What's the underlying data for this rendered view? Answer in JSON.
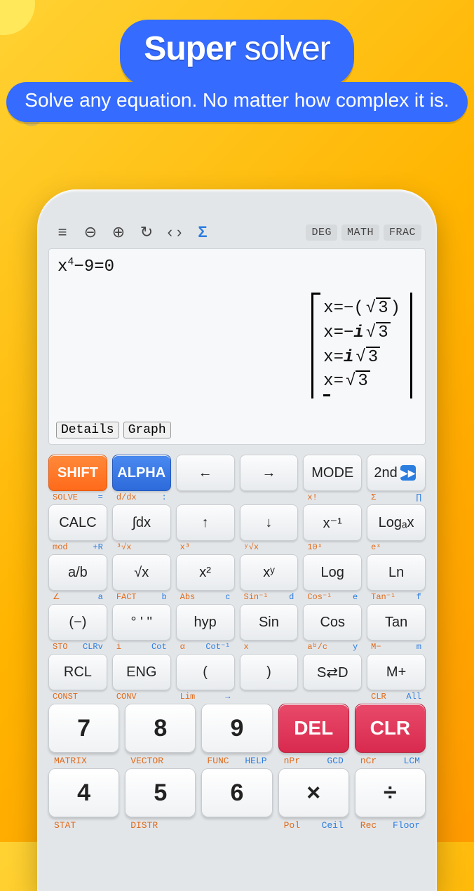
{
  "hero": {
    "title_strong": "Super",
    "title_rest": " solver",
    "subtitle": "Solve any equation. No matter how complex it is."
  },
  "toolbar": {
    "menu": "≡",
    "zoom_out": "⊖",
    "zoom_in": "⊕",
    "refresh": "↻",
    "code": "‹ ›",
    "sigma": "Σ",
    "modes": [
      "DEG",
      "MATH",
      "FRAC"
    ]
  },
  "display": {
    "expression_base": "x",
    "expression_exp": "4",
    "expression_rest": "−9=0",
    "solutions": {
      "s1_pre": "x=−(",
      "s1_rad": "3",
      "s1_post": ")",
      "s2_pre": "x=−",
      "s2_i": "i",
      "s2_rad": "3",
      "s3_pre": "x=",
      "s3_i": "i",
      "s3_rad": "3",
      "s4_pre": "x=",
      "s4_rad": "3"
    },
    "details_btn": "Details",
    "graph_btn": "Graph"
  },
  "row1": {
    "shift": "SHIFT",
    "alpha": "ALPHA",
    "left": "←",
    "right": "→",
    "mode": "MODE",
    "second": "2nd"
  },
  "hints1": [
    {
      "l": "SOLVE",
      "r": "="
    },
    {
      "l": "d/dx",
      "r": ":"
    },
    {
      "l": "",
      "r": ""
    },
    {
      "l": "",
      "r": ""
    },
    {
      "l": "x!",
      "r": ""
    },
    {
      "l": "Σ",
      "r": "∏"
    }
  ],
  "row2": [
    "CALC",
    "∫dx",
    "↑",
    "↓",
    "x⁻¹",
    "Logₐx"
  ],
  "hints2": [
    {
      "l": "mod",
      "r": "+R"
    },
    {
      "l": "³√x",
      "r": ""
    },
    {
      "l": "x³",
      "r": ""
    },
    {
      "l": "ʸ√x",
      "r": ""
    },
    {
      "l": "10ˣ",
      "r": ""
    },
    {
      "l": "eˣ",
      "r": ""
    }
  ],
  "row3": [
    "a/b",
    "√x",
    "x²",
    "xʸ",
    "Log",
    "Ln"
  ],
  "hints3": [
    {
      "l": "∠",
      "r": "a"
    },
    {
      "l": "FACT",
      "r": "b"
    },
    {
      "l": "Abs",
      "r": "c"
    },
    {
      "l": "Sin⁻¹",
      "r": "d"
    },
    {
      "l": "Cos⁻¹",
      "r": "e"
    },
    {
      "l": "Tan⁻¹",
      "r": "f"
    }
  ],
  "row4": [
    "(−)",
    "° ' ''",
    "hyp",
    "Sin",
    "Cos",
    "Tan"
  ],
  "hints4": [
    {
      "l": "STO",
      "r": "CLRv"
    },
    {
      "l": "i",
      "r": "Cot"
    },
    {
      "l": "α",
      "r": "Cot⁻¹"
    },
    {
      "l": "x",
      "r": ""
    },
    {
      "l": "aᵇ/c",
      "r": "y"
    },
    {
      "l": "M−",
      "r": "m"
    }
  ],
  "row5": [
    "RCL",
    "ENG",
    "(",
    ")",
    "S⇄D",
    "M+"
  ],
  "hints5": [
    {
      "l": "CONST",
      "r": ""
    },
    {
      "l": "CONV",
      "r": ""
    },
    {
      "l": "Lim",
      "r": "→"
    },
    {
      "l": "",
      "r": ""
    },
    {
      "l": "",
      "r": ""
    },
    {
      "l": "CLR",
      "r": "All"
    }
  ],
  "numrow1": [
    "7",
    "8",
    "9",
    "DEL",
    "CLR"
  ],
  "nhints1": [
    {
      "l": "MATRIX",
      "r": ""
    },
    {
      "l": "VECTOR",
      "r": ""
    },
    {
      "l": "FUNC",
      "r": "HELP"
    },
    {
      "l": "nPr",
      "r": "GCD"
    },
    {
      "l": "nCr",
      "r": "LCM"
    }
  ],
  "numrow2": [
    "4",
    "5",
    "6",
    "×",
    "÷"
  ],
  "nhints2": [
    {
      "l": "STAT",
      "r": ""
    },
    {
      "l": "DISTR",
      "r": ""
    },
    {
      "l": "",
      "r": ""
    },
    {
      "l": "Pol",
      "r": "Ceil"
    },
    {
      "l": "Rec",
      "r": "Floor"
    }
  ]
}
